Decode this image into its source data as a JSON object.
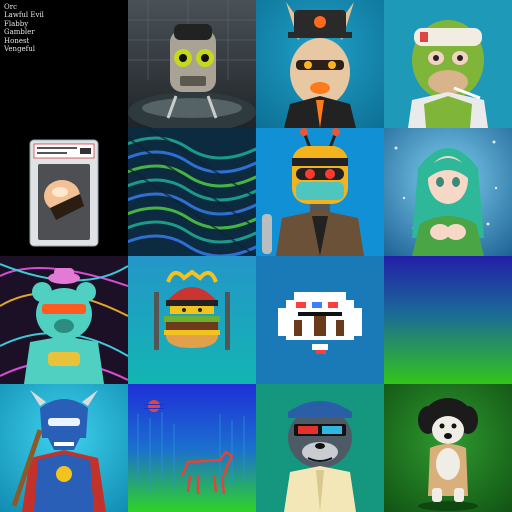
{
  "traits_panel": {
    "items": [
      "Orc",
      "Lawful Evil",
      "Flabby",
      "Gambler",
      "Honest",
      "Vengeful"
    ]
  },
  "tiles": [
    {
      "icon": "text-traits-list"
    },
    {
      "icon": "robot-head-in-water-art"
    },
    {
      "icon": "rabbit-with-hat-art"
    },
    {
      "icon": "bandaged-ape-art"
    },
    {
      "icon": "graded-card-slab-art"
    },
    {
      "icon": "abstract-swirl-pattern-art"
    },
    {
      "icon": "bee-robot-with-mask-art"
    },
    {
      "icon": "anime-girl-art"
    },
    {
      "icon": "bear-with-sunglasses-art"
    },
    {
      "icon": "samurai-burger-art"
    },
    {
      "icon": "pixel-cloud-art"
    },
    {
      "icon": "blue-green-gradient-art"
    },
    {
      "icon": "armored-viking-hero-art"
    },
    {
      "icon": "glitch-horse-art"
    },
    {
      "icon": "otter-with-3d-glasses-art"
    },
    {
      "icon": "dog-figurine-art"
    }
  ]
}
